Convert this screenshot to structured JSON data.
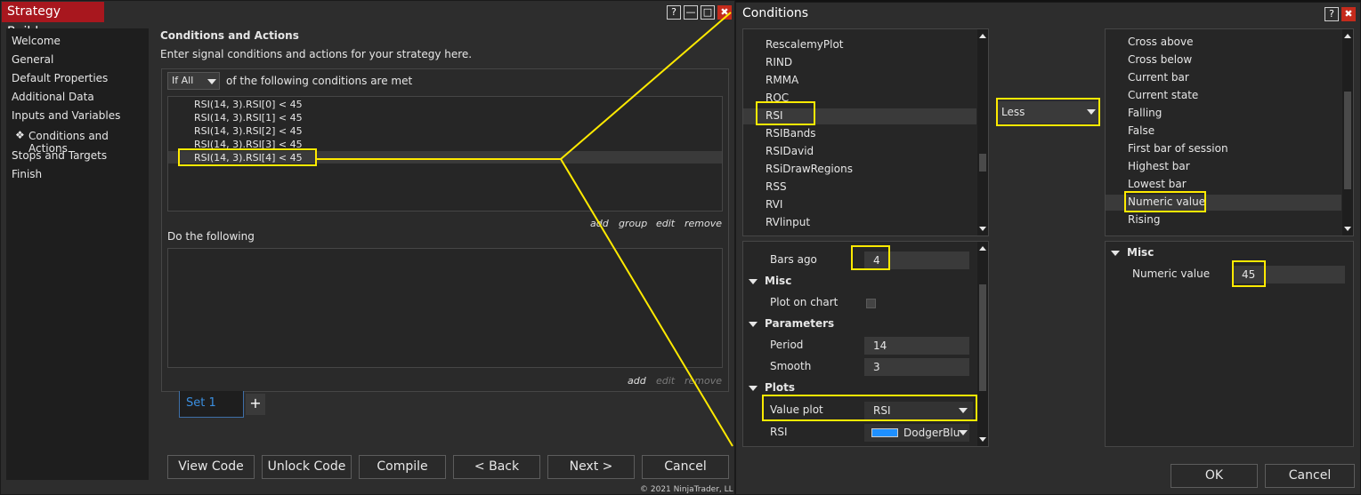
{
  "strategy_builder": {
    "title": "Strategy Builder",
    "window_controls": {
      "help": "?",
      "minimize": "—",
      "maximize": "□",
      "close": "✖"
    },
    "nav": [
      "Welcome",
      "General",
      "Default Properties",
      "Additional Data",
      "Inputs and Variables",
      "Conditions and Actions",
      "Stops and Targets",
      "Finish"
    ],
    "selected_nav_marker": "❖",
    "heading": "Conditions and Actions",
    "subheading": "Enter signal conditions and actions for your strategy here.",
    "match_select": "If All",
    "match_text": "of the following conditions are met",
    "conditions": [
      "RSI(14, 3).RSI[0] < 45",
      "RSI(14, 3).RSI[1] < 45",
      "RSI(14, 3).RSI[2] < 45",
      "RSI(14, 3).RSI[3] < 45",
      "RSI(14, 3).RSI[4] < 45"
    ],
    "cond_links": {
      "add": "add",
      "group": "group",
      "edit": "edit",
      "remove": "remove"
    },
    "actions_label": "Do the following",
    "action_links": {
      "add": "add",
      "edit": "edit",
      "remove": "remove"
    },
    "set_tab": "Set 1",
    "add_set": "+",
    "buttons": {
      "view_code": "View Code",
      "unlock_code": "Unlock Code",
      "compile": "Compile",
      "back": "< Back",
      "next": "Next >",
      "cancel": "Cancel"
    },
    "footer_text": "© 2021 NinjaTrader, LL"
  },
  "conditions_dialog": {
    "title": "Conditions",
    "help": "?",
    "close": "✖",
    "indicators": [
      "RescalemyPlot",
      "RIND",
      "RMMA",
      "ROC",
      "RSI",
      "RSIBands",
      "RSIDavid",
      "RSiDrawRegions",
      "RSS",
      "RVI",
      "RVlinput"
    ],
    "left_props": {
      "bars_ago_label": "Bars ago",
      "bars_ago_value": "4",
      "misc_header": "Misc",
      "plot_on_chart_label": "Plot on chart",
      "parameters_header": "Parameters",
      "period_label": "Period",
      "period_value": "14",
      "smooth_label": "Smooth",
      "smooth_value": "3",
      "plots_header": "Plots",
      "value_plot_label": "Value plot",
      "value_plot_value": "RSI",
      "rsi_label": "RSI",
      "rsi_color_name": "DodgerBlu"
    },
    "operator": "Less",
    "right_items": [
      "Cross above",
      "Cross below",
      "Current bar",
      "Current state",
      "Falling",
      "False",
      "First bar of session",
      "Highest bar",
      "Lowest bar",
      "Numeric value",
      "Rising"
    ],
    "right_props": {
      "misc_header": "Misc",
      "numeric_value_label": "Numeric value",
      "numeric_value": "45"
    },
    "ok": "OK",
    "cancel": "Cancel"
  },
  "colors": {
    "highlight": "#ffea00",
    "title_red": "#a8171e",
    "accent_blue": "#1e90ff",
    "dodger_blue": "#1e90ff"
  }
}
